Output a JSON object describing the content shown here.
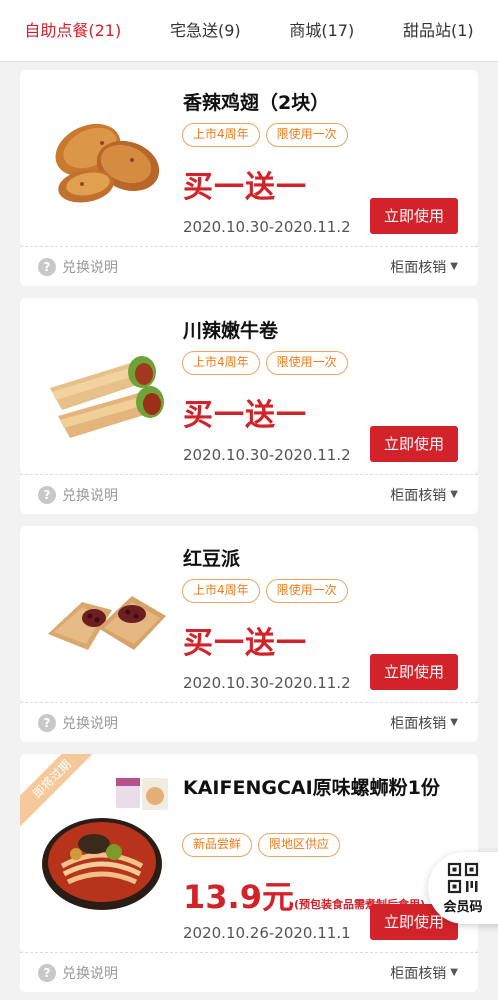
{
  "tabs": [
    {
      "label": "自助点餐(21)"
    },
    {
      "label": "宅急送(9)"
    },
    {
      "label": "商城(17)"
    },
    {
      "label": "甜品站(1)"
    }
  ],
  "colors": {
    "accent": "#d2232a",
    "tag": "#f27a1a",
    "ribbon": "#f6c99c"
  },
  "coupons": [
    {
      "title": "香辣鸡翅（2块）",
      "tags": [
        "上市4周年",
        "限使用一次"
      ],
      "promo": "买一送一",
      "dates": "2020.10.30-2020.11.2",
      "button": "立即使用",
      "help": "兑换说明",
      "verify": "柜面核销",
      "image": "chicken-wings"
    },
    {
      "title": "川辣嫩牛卷",
      "tags": [
        "上市4周年",
        "限使用一次"
      ],
      "promo": "买一送一",
      "dates": "2020.10.30-2020.11.2",
      "button": "立即使用",
      "help": "兑换说明",
      "verify": "柜面核销",
      "image": "beef-wrap"
    },
    {
      "title": "红豆派",
      "tags": [
        "上市4周年",
        "限使用一次"
      ],
      "promo": "买一送一",
      "dates": "2020.10.30-2020.11.2",
      "button": "立即使用",
      "help": "兑换说明",
      "verify": "柜面核销",
      "image": "red-bean-pie"
    },
    {
      "title": "KAIFENGCAI原味螺蛳粉1份",
      "tags": [
        "新品尝鲜",
        "限地区供应"
      ],
      "price": "13.9元",
      "price_note": "(预包装食品需煮制后食用)",
      "ribbon": "即将过期",
      "dates": "2020.10.26-2020.11.1",
      "button": "立即使用",
      "help": "兑换说明",
      "verify": "柜面核销",
      "image": "snail-noodles"
    }
  ],
  "member_button": {
    "label": "会员码",
    "icon": "qr-code-icon"
  }
}
